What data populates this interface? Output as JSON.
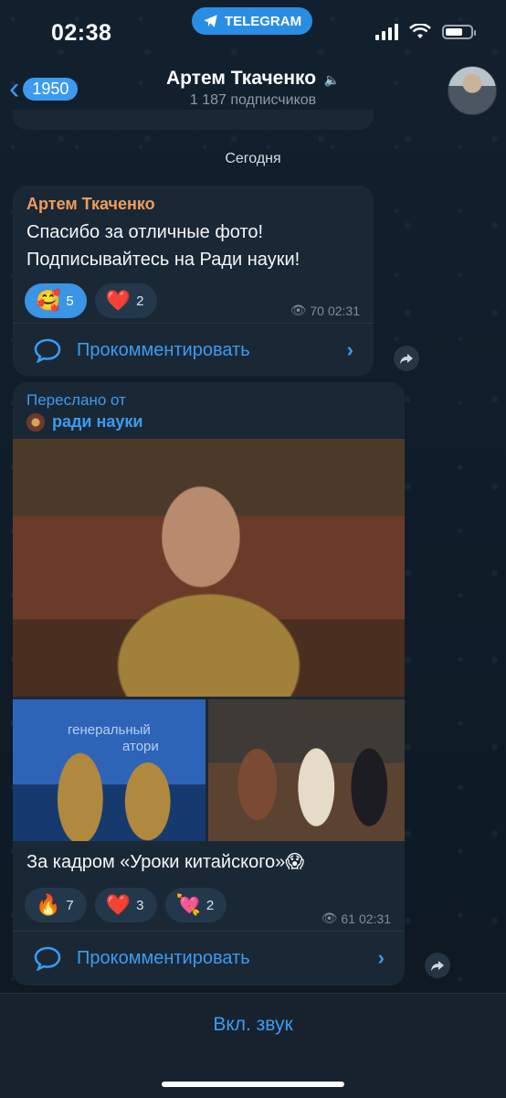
{
  "status_bar": {
    "time": "02:38",
    "app_pill": "TELEGRAM",
    "battery_level": 0.7
  },
  "header": {
    "back_count": "1950",
    "title": "Артем Ткаченко",
    "subtitle": "1 187 подписчиков",
    "mute_icon": "speaker-muted-icon"
  },
  "date_separator": "Сегодня",
  "message1": {
    "author": "Артем Ткаченко",
    "lines": [
      "Спасибо за отличные фото!",
      "Подписывайтесь на Ради науки!"
    ],
    "reactions": [
      {
        "emoji": "🥰",
        "count": "5",
        "active": true
      },
      {
        "emoji": "❤️",
        "count": "2",
        "active": false
      }
    ],
    "views": "70",
    "time": "02:31",
    "comment_label": "Прокомментировать"
  },
  "message2": {
    "forwarded_label": "Переслано от",
    "source": "ради науки",
    "photo_text": [
      "генеральный",
      "атори"
    ],
    "caption": "За кадром «Уроки китайского»😱",
    "reactions": [
      {
        "emoji": "🔥",
        "count": "7"
      },
      {
        "emoji": "❤️",
        "count": "3"
      },
      {
        "emoji": "💘",
        "count": "2"
      }
    ],
    "views": "61",
    "time": "02:31",
    "comment_label": "Прокомментировать"
  },
  "bottom": {
    "unmute_label": "Вкл. звук"
  },
  "colors": {
    "accent": "#3c9bf0",
    "author": "#f29c5a",
    "bubble": "#1a2836"
  }
}
